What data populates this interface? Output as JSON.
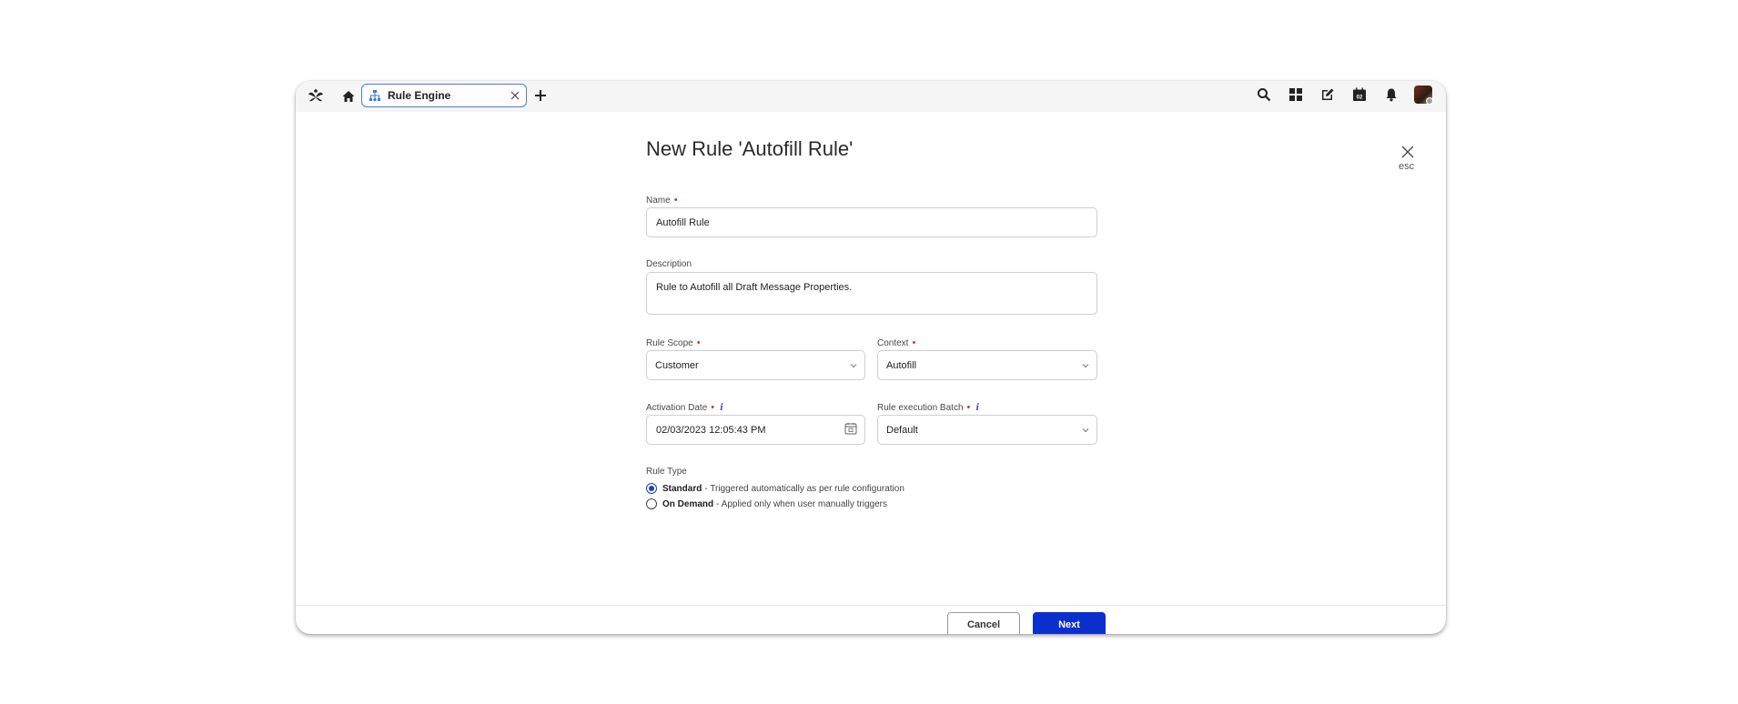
{
  "tabs": [
    {
      "label": "Rule Engine"
    }
  ],
  "dialog": {
    "title": "New Rule 'Autofill Rule'",
    "esc_label": "esc"
  },
  "form": {
    "name": {
      "label": "Name",
      "value": "Autofill Rule",
      "required": true
    },
    "description": {
      "label": "Description",
      "value": "Rule to Autofill all Draft Message Properties."
    },
    "rule_scope": {
      "label": "Rule Scope",
      "value": "Customer",
      "required": true
    },
    "context": {
      "label": "Context",
      "value": "Autofill",
      "required": true
    },
    "activation_date": {
      "label": "Activation Date",
      "value": "02/03/2023 12:05:43 PM",
      "required": true
    },
    "rule_execution_batch": {
      "label": "Rule execution Batch",
      "value": "Default",
      "required": true
    },
    "rule_type": {
      "label": "Rule Type",
      "options": [
        {
          "title": "Standard",
          "desc": " - Triggered automatically as per rule configuration",
          "selected": true
        },
        {
          "title": "On Demand",
          "desc": " - Applied only when user manually triggers",
          "selected": false
        }
      ]
    }
  },
  "footer": {
    "cancel_label": "Cancel",
    "next_label": "Next"
  },
  "calendar_day": "02",
  "colors": {
    "primary": "#0a2fce",
    "required": "#d93025",
    "tab_border": "#4a7fd6"
  }
}
